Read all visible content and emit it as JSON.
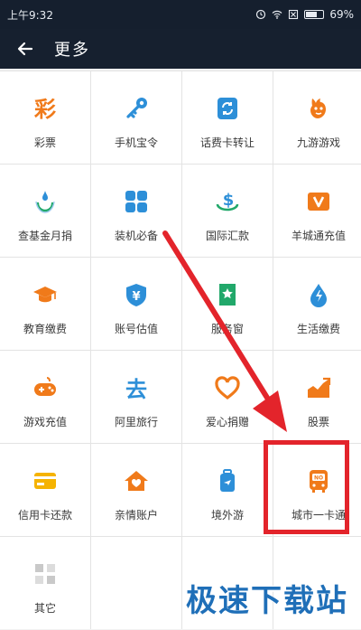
{
  "status_bar": {
    "time": "上午9:32",
    "battery": "69%",
    "battery_level": 0.69
  },
  "header": {
    "back_icon": "arrow-left-icon",
    "title": "更多"
  },
  "grid": [
    {
      "id": "lottery",
      "label": "彩票",
      "icon": "lottery-icon"
    },
    {
      "id": "phone-token",
      "label": "手机宝令",
      "icon": "key-icon"
    },
    {
      "id": "recharge-card-transfer",
      "label": "话费卡转让",
      "icon": "refresh-card-icon"
    },
    {
      "id": "nine-games",
      "label": "九游游戏",
      "icon": "game-mascot-icon"
    },
    {
      "id": "check-fund-donation",
      "label": "查基金月捐",
      "icon": "smile-drop-icon"
    },
    {
      "id": "must-have-apps",
      "label": "装机必备",
      "icon": "apps-grid-icon"
    },
    {
      "id": "international-remit",
      "label": "国际汇款",
      "icon": "currency-exchange-icon"
    },
    {
      "id": "yangcheng-recharge",
      "label": "羊城通充值",
      "icon": "v-card-icon"
    },
    {
      "id": "education-fee",
      "label": "教育缴费",
      "icon": "graduation-cap-icon"
    },
    {
      "id": "account-valuation",
      "label": "账号估值",
      "icon": "shield-yuan-icon"
    },
    {
      "id": "partial-service",
      "label": "服务窗",
      "icon": "star-bookmark-icon"
    },
    {
      "id": "utility-fee",
      "label": "生活缴费",
      "icon": "water-drop-icon"
    },
    {
      "id": "game-recharge",
      "label": "游戏充值",
      "icon": "gamepad-icon"
    },
    {
      "id": "ali-travel",
      "label": "阿里旅行",
      "icon": "travel-go-icon"
    },
    {
      "id": "charity",
      "label": "爱心捐赠",
      "icon": "heart-icon"
    },
    {
      "id": "stocks",
      "label": "股票",
      "icon": "stock-chart-icon"
    },
    {
      "id": "credit-card-repay",
      "label": "信用卡还款",
      "icon": "credit-card-icon"
    },
    {
      "id": "family-account",
      "label": "亲情账户",
      "icon": "house-heart-icon"
    },
    {
      "id": "overseas-travel",
      "label": "境外游",
      "icon": "luggage-plane-icon"
    },
    {
      "id": "city-card",
      "label": "城市一卡通",
      "icon": "bus-card-icon"
    },
    {
      "id": "others",
      "label": "其它",
      "icon": "more-grid-icon"
    }
  ],
  "watermark": "极速下载站",
  "colors": {
    "header_bg": "#16202f",
    "highlight": "#e3242b",
    "orange": "#f07a1a",
    "blue": "#2d8fd8",
    "green": "#21a86a"
  }
}
